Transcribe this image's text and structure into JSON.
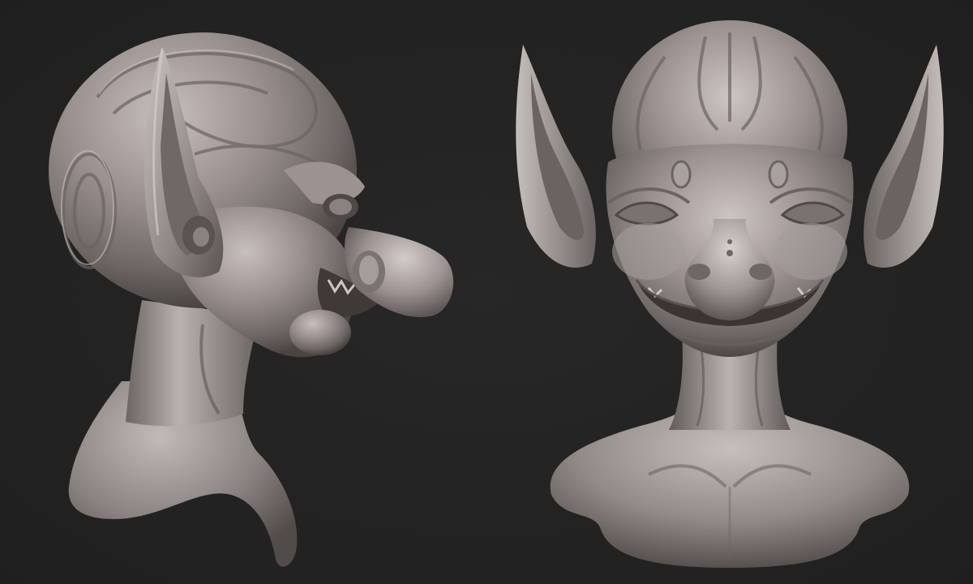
{
  "scene": {
    "background_color": "#232323",
    "material_color": "#8a8280",
    "views": [
      {
        "id": "side",
        "subject": "goblin-bust-sculpt",
        "orientation": "profile-right"
      },
      {
        "id": "front",
        "subject": "goblin-bust-sculpt",
        "orientation": "front"
      }
    ]
  }
}
